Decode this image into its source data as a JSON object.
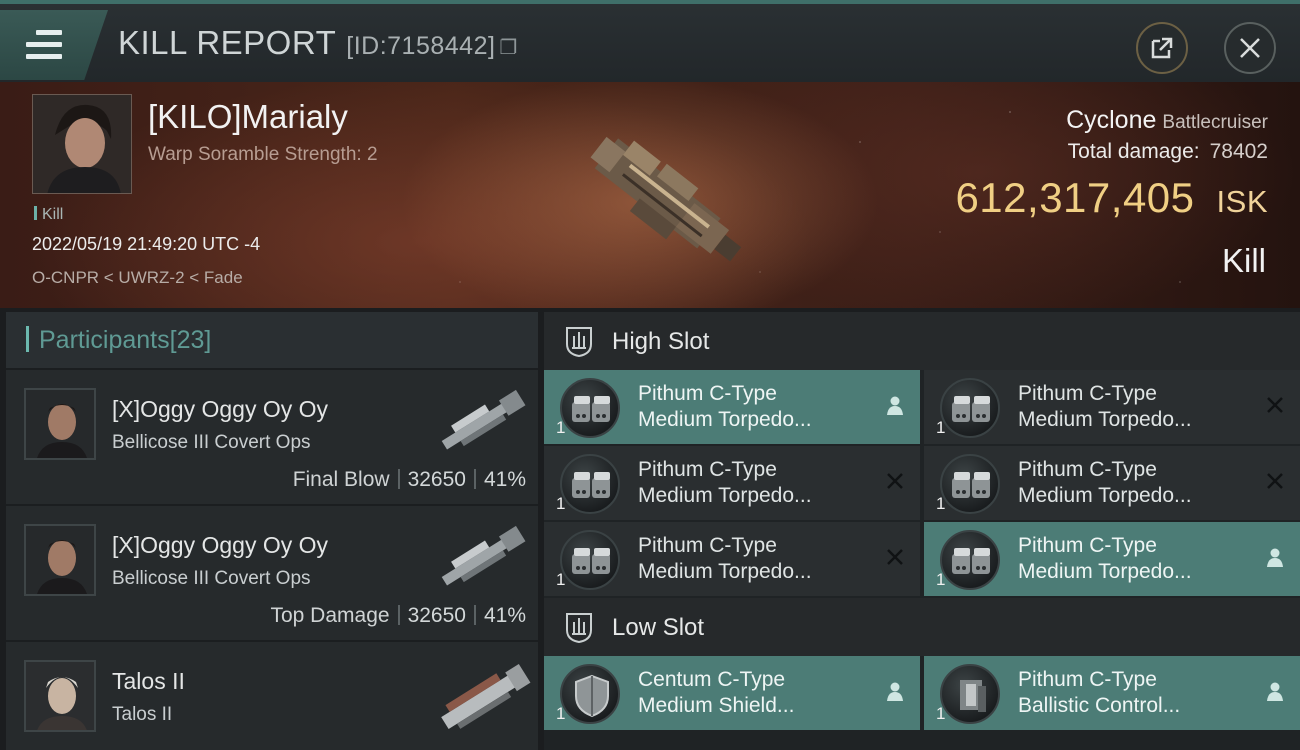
{
  "header": {
    "title": "KILL REPORT",
    "report_id": "[ID:7158442]"
  },
  "victim": {
    "name": "[KILO]Marialy",
    "warp_scramble": "Warp Soramble Strength: 2",
    "tag": "Kill",
    "datetime": "2022/05/19 21:49:20 UTC -4",
    "location": "O-CNPR < UWRZ-2 < Fade",
    "ship_name": "Cyclone",
    "ship_class": "Battlecruiser",
    "total_damage_label": "Total damage:",
    "total_damage_value": "78402",
    "isk_value": "612,317,405",
    "isk_unit": "ISK",
    "result": "Kill"
  },
  "participants": {
    "label": "Participants",
    "count": "[23]",
    "rows": [
      {
        "name": "[X]Oggy Oggy Oy Oy",
        "ship": "Bellicose III Covert Ops",
        "label": "Final Blow",
        "damage": "32650",
        "percent": "41%"
      },
      {
        "name": "[X]Oggy Oggy Oy Oy",
        "ship": "Bellicose III Covert Ops",
        "label": "Top Damage",
        "damage": "32650",
        "percent": "41%"
      },
      {
        "name": "Talos II",
        "ship": "Talos II",
        "label": "",
        "damage": "",
        "percent": ""
      }
    ]
  },
  "high_slot": {
    "label": "High Slot",
    "modules": [
      {
        "line1": "Pithum C-Type",
        "line2": "Medium Torpedo...",
        "qty": "1",
        "status": "person-icon",
        "active": true
      },
      {
        "line1": "Pithum C-Type",
        "line2": "Medium Torpedo...",
        "qty": "1",
        "status": "cross-icon",
        "active": false
      },
      {
        "line1": "Pithum C-Type",
        "line2": "Medium Torpedo...",
        "qty": "1",
        "status": "cross-icon",
        "active": false
      },
      {
        "line1": "Pithum C-Type",
        "line2": "Medium Torpedo...",
        "qty": "1",
        "status": "cross-icon",
        "active": false
      },
      {
        "line1": "Pithum C-Type",
        "line2": "Medium Torpedo...",
        "qty": "1",
        "status": "cross-icon",
        "active": false
      },
      {
        "line1": "Pithum C-Type",
        "line2": "Medium Torpedo...",
        "qty": "1",
        "status": "person-icon",
        "active": true
      }
    ]
  },
  "low_slot": {
    "label": "Low Slot",
    "modules": [
      {
        "line1": "Centum C-Type",
        "line2": "Medium Shield...",
        "qty": "1",
        "status": "person-icon",
        "active": true
      },
      {
        "line1": "Pithum C-Type",
        "line2": "Ballistic Control...",
        "qty": "1",
        "status": "person-icon",
        "active": true
      }
    ]
  },
  "colors": {
    "accent_teal": "#4c7c76",
    "isk_gold": "#f0cf84",
    "header_teal": "#3f6f69"
  }
}
